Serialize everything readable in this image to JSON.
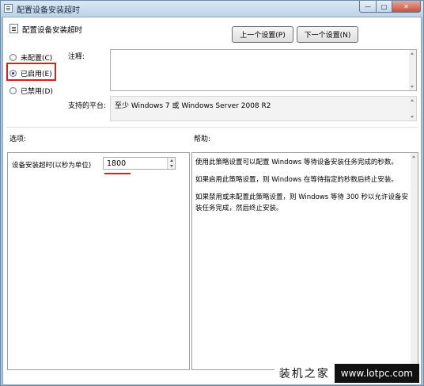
{
  "window": {
    "title": "配置设备安装超时",
    "controls": {
      "minimize": "—",
      "maximize": "□",
      "close": "✕"
    }
  },
  "header": {
    "title": "配置设备安装超时",
    "prev_button": "上一个设置(P)",
    "next_button": "下一个设置(N)"
  },
  "state": {
    "options": [
      {
        "label": "未配置(C)",
        "checked": false
      },
      {
        "label": "已启用(E)",
        "checked": true
      },
      {
        "label": "已禁用(D)",
        "checked": false
      }
    ]
  },
  "comment": {
    "label": "注释:",
    "value": ""
  },
  "platform": {
    "label": "支持的平台:",
    "value": "至少 Windows 7 或 Windows Server 2008 R2"
  },
  "options_section": {
    "label": "选项:",
    "timeout_label": "设备安装超时(以秒为单位)",
    "timeout_value": "1800"
  },
  "help_section": {
    "label": "帮助:",
    "paragraphs": [
      "使用此策略设置可以配置 Windows 等待设备安装任务完成的秒数。",
      "如果启用此策略设置，则 Windows 在等待指定的秒数后终止安装。",
      "如果禁用或未配置此策略设置，则 Windows 等待 300 秒以允许设备安装任务完成，然后终止安装。"
    ]
  },
  "watermark": {
    "brand": "装机之家",
    "url": "www.lotpc.com"
  },
  "colors": {
    "highlight": "#d32020",
    "titlebar": "#bdd2e8"
  }
}
